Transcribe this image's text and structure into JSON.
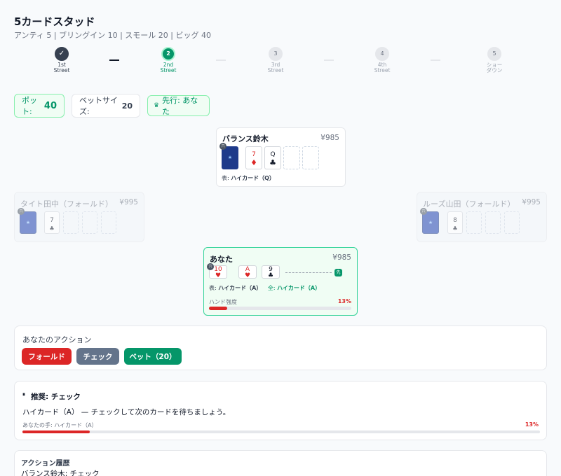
{
  "header": {
    "title": "5カードスタッド",
    "subtitle": "アンティ 5 | ブリングイン 10 | スモール 20 | ビッグ 40"
  },
  "stepper": [
    {
      "symbol": "✓",
      "line1": "1st",
      "line2": "Street",
      "state": "done"
    },
    {
      "symbol": "2",
      "line1": "2nd",
      "line2": "Street",
      "state": "active"
    },
    {
      "symbol": "3",
      "line1": "3rd",
      "line2": "Street",
      "state": "pending"
    },
    {
      "symbol": "4",
      "line1": "4th",
      "line2": "Street",
      "state": "pending"
    },
    {
      "symbol": "5",
      "line1": "ショー",
      "line2": "ダウン",
      "state": "pending"
    }
  ],
  "info": {
    "pot_label": "ポット:",
    "pot_value": "40",
    "bet_label": "ベットサイズ:",
    "bet_value": "20",
    "first_icon": "♛",
    "first_text": "先行: あなた"
  },
  "players": {
    "top": {
      "name": "バランス鈴木",
      "chips": "¥985",
      "hole_badge": "穴",
      "back_symbol": "★",
      "upcards": [
        {
          "rank": "7",
          "suit": "♦",
          "color": "red"
        },
        {
          "rank": "Q",
          "suit": "♣",
          "color": "black"
        }
      ],
      "desc_label": "表:",
      "desc_value": "ハイカード（Q）"
    },
    "left": {
      "name": "タイト田中（フォールド）",
      "chips": "¥995",
      "hole_badge": "穴",
      "back_symbol": "★",
      "upcards": [
        {
          "rank": "7",
          "suit": "♣",
          "color": "black"
        }
      ]
    },
    "right": {
      "name": "ルーズ山田（フォールド）",
      "chips": "¥995",
      "hole_badge": "穴",
      "back_symbol": "★",
      "upcards": [
        {
          "rank": "8",
          "suit": "♣",
          "color": "black"
        }
      ]
    },
    "you": {
      "name": "あなた",
      "chips": "¥985",
      "hole_badge": "穴",
      "cards": [
        {
          "rank": "10",
          "suit": "♥",
          "color": "red"
        },
        {
          "rank": "A",
          "suit": "♥",
          "color": "red"
        },
        {
          "rank": "9",
          "suit": "♣",
          "color": "black"
        }
      ],
      "first_badge": "先",
      "desc_up_label": "表:",
      "desc_up_value": "ハイカード（A）",
      "desc_all_label": "全:",
      "desc_all_value": "ハイカード（A）",
      "strength_label": "ハンド強度",
      "strength_text": "13%",
      "strength": 0.13
    }
  },
  "actions": {
    "title": "あなたのアクション",
    "fold": "フォールド",
    "check": "チェック",
    "bet": "ベット（20）"
  },
  "recommend": {
    "icon": "⏸",
    "title": "推奨: チェック",
    "text": "ハイカード（A） — チェックして次のカードを待ちましょう。",
    "hand_label": "あなたの手: ハイカード（A）",
    "hand_pct": "13%",
    "strength": 0.13
  },
  "history": {
    "title": "アクション履歴",
    "entry": "バランス鈴木: チェック"
  },
  "colors": {
    "accent": "#059669",
    "danger": "#dc2626",
    "neutral": "#64748b",
    "card_back": "#1e3a8a"
  }
}
